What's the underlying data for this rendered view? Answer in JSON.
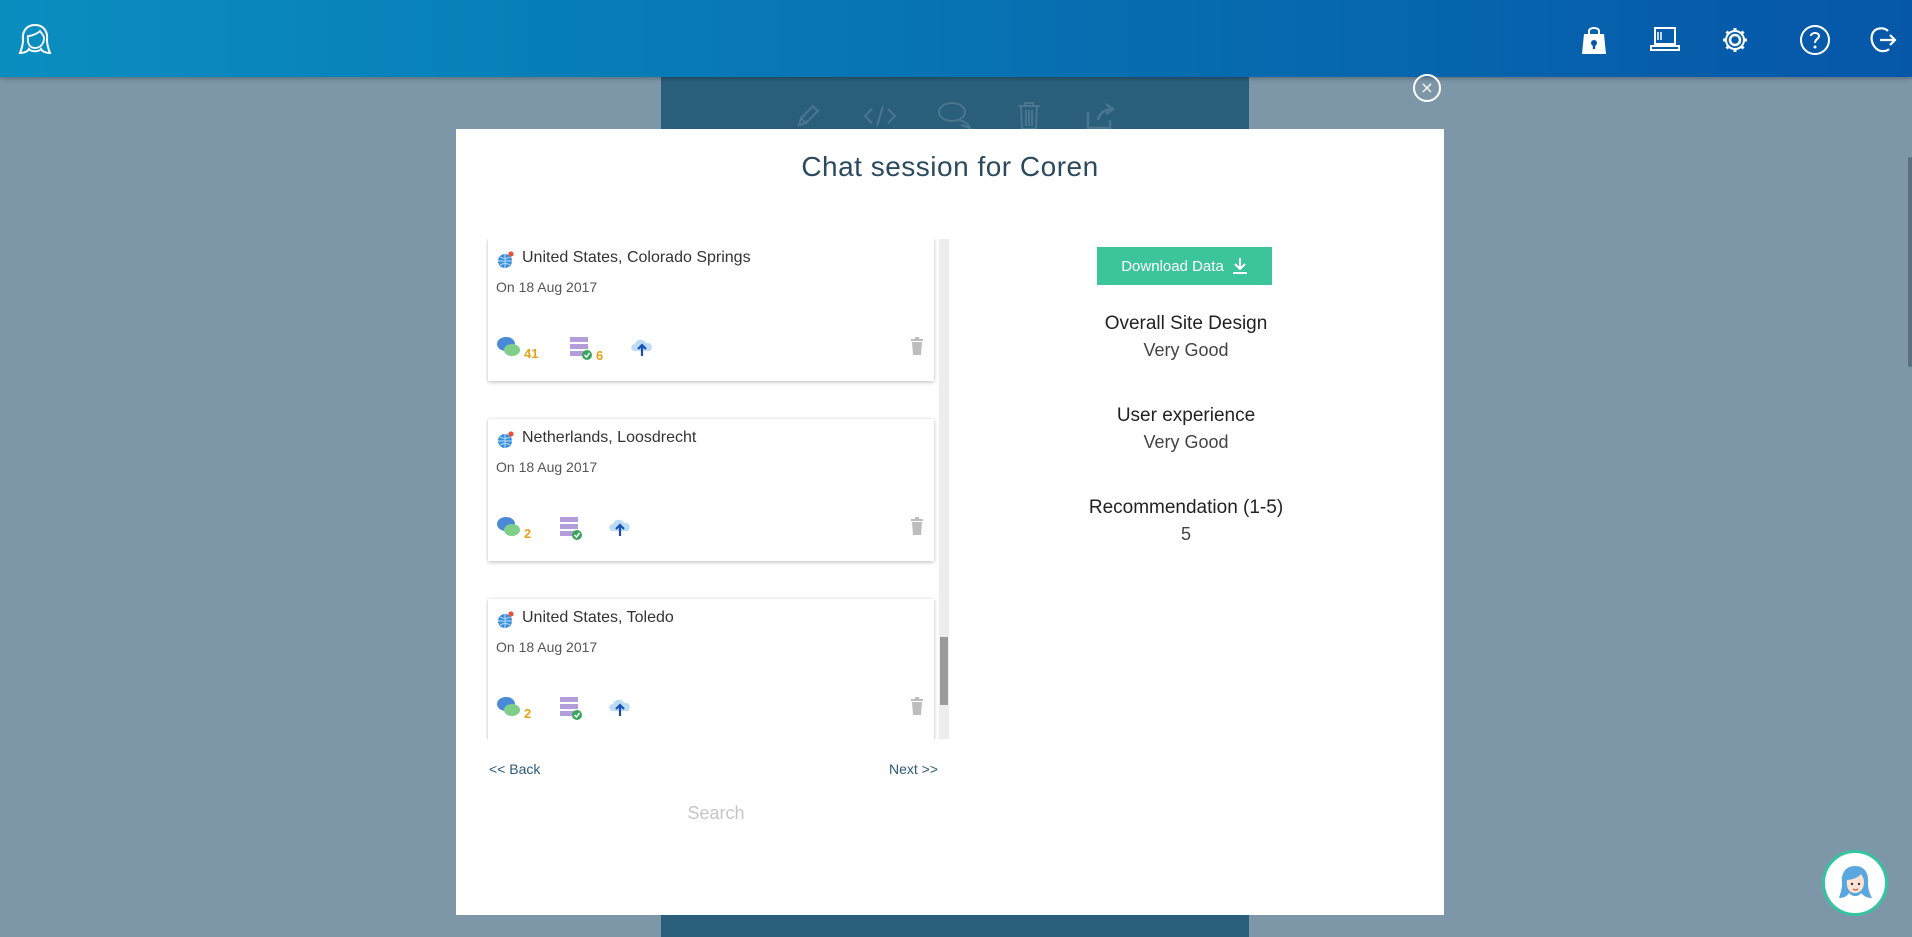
{
  "header": {
    "icons": [
      "user-avatar-logo-icon",
      "shopping-bag-icon",
      "devices-icon",
      "gear-icon",
      "help-icon",
      "logout-icon"
    ]
  },
  "background_toolbar": {
    "icons": [
      "pencil-icon",
      "code-icon",
      "chat-bubbles-icon",
      "trash-icon",
      "share-icon"
    ]
  },
  "modal": {
    "title": "Chat session for Coren",
    "close_label": "×",
    "sessions": [
      {
        "location": "United States, Colorado Springs",
        "date": "On 18 Aug 2017",
        "messages": "41",
        "data_count": "6"
      },
      {
        "location": "Netherlands, Loosdrecht",
        "date": "On 18 Aug 2017",
        "messages": "2",
        "data_count": ""
      },
      {
        "location": "United States, Toledo",
        "date": "On 18 Aug 2017",
        "messages": "2",
        "data_count": ""
      }
    ],
    "back_label": "<< Back",
    "next_label": "Next >>",
    "search_placeholder": "Search",
    "download_label": "Download Data",
    "answers": [
      {
        "question": "Overall Site Design",
        "answer": "Very Good"
      },
      {
        "question": "User experience",
        "answer": "Very Good"
      },
      {
        "question": "Recommendation (1-5)",
        "answer": "5"
      }
    ]
  },
  "colors": {
    "header_start": "#0a8ec0",
    "header_end": "#0657a8",
    "accent_green": "#3cc49a",
    "count_orange": "#e8a21a"
  }
}
